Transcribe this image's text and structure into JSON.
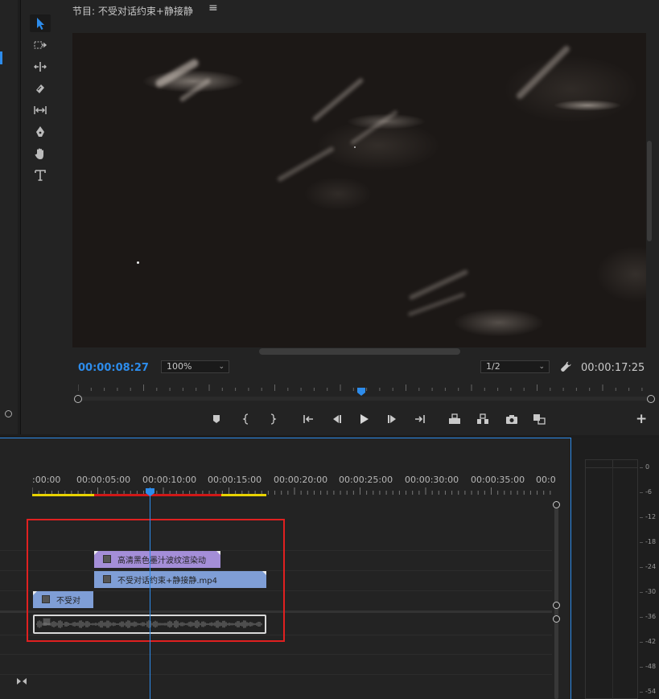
{
  "program_monitor": {
    "title": "节目: 不受对话约束+静接静",
    "menu_icon": "≡",
    "current_timecode": "00:00:08:27",
    "zoom": "100%",
    "resolution": "1/2",
    "total_timecode": "00:00:17:25",
    "add_button": "+"
  },
  "tools": [
    "selection-tool",
    "track-select-tool",
    "ripple-edit-tool",
    "razor-tool",
    "slip-tool",
    "pen-tool",
    "hand-tool",
    "type-tool"
  ],
  "transport": [
    "add-marker",
    "mark-in",
    "mark-out",
    "go-to-in",
    "step-back",
    "play",
    "step-forward",
    "go-to-out",
    "lift",
    "extract",
    "export-frame",
    "comparison-view"
  ],
  "timeline": {
    "ruler_labels": [
      ":00:00",
      "00:00:05:00",
      "00:00:10:00",
      "00:00:15:00",
      "00:00:20:00",
      "00:00:25:00",
      "00:00:30:00",
      "00:00:35:00",
      "00:0"
    ],
    "clips": {
      "purple": "高清黑色墨汁波纹渲染动",
      "blue": "不受对话约束+静接静.mp4",
      "short": "不受对"
    }
  },
  "audio_meter": {
    "db_labels": [
      "0",
      "-6",
      "-12",
      "-18",
      "-24",
      "-30",
      "-36",
      "-42",
      "-48",
      "-54"
    ]
  },
  "colors": {
    "accent": "#2d8ceb",
    "clip_purple": "#a48ed8",
    "clip_blue": "#7f9ed6",
    "work_area_yellow": "#e8d200",
    "work_area_red": "#d01818",
    "highlight_box": "#e02020"
  }
}
